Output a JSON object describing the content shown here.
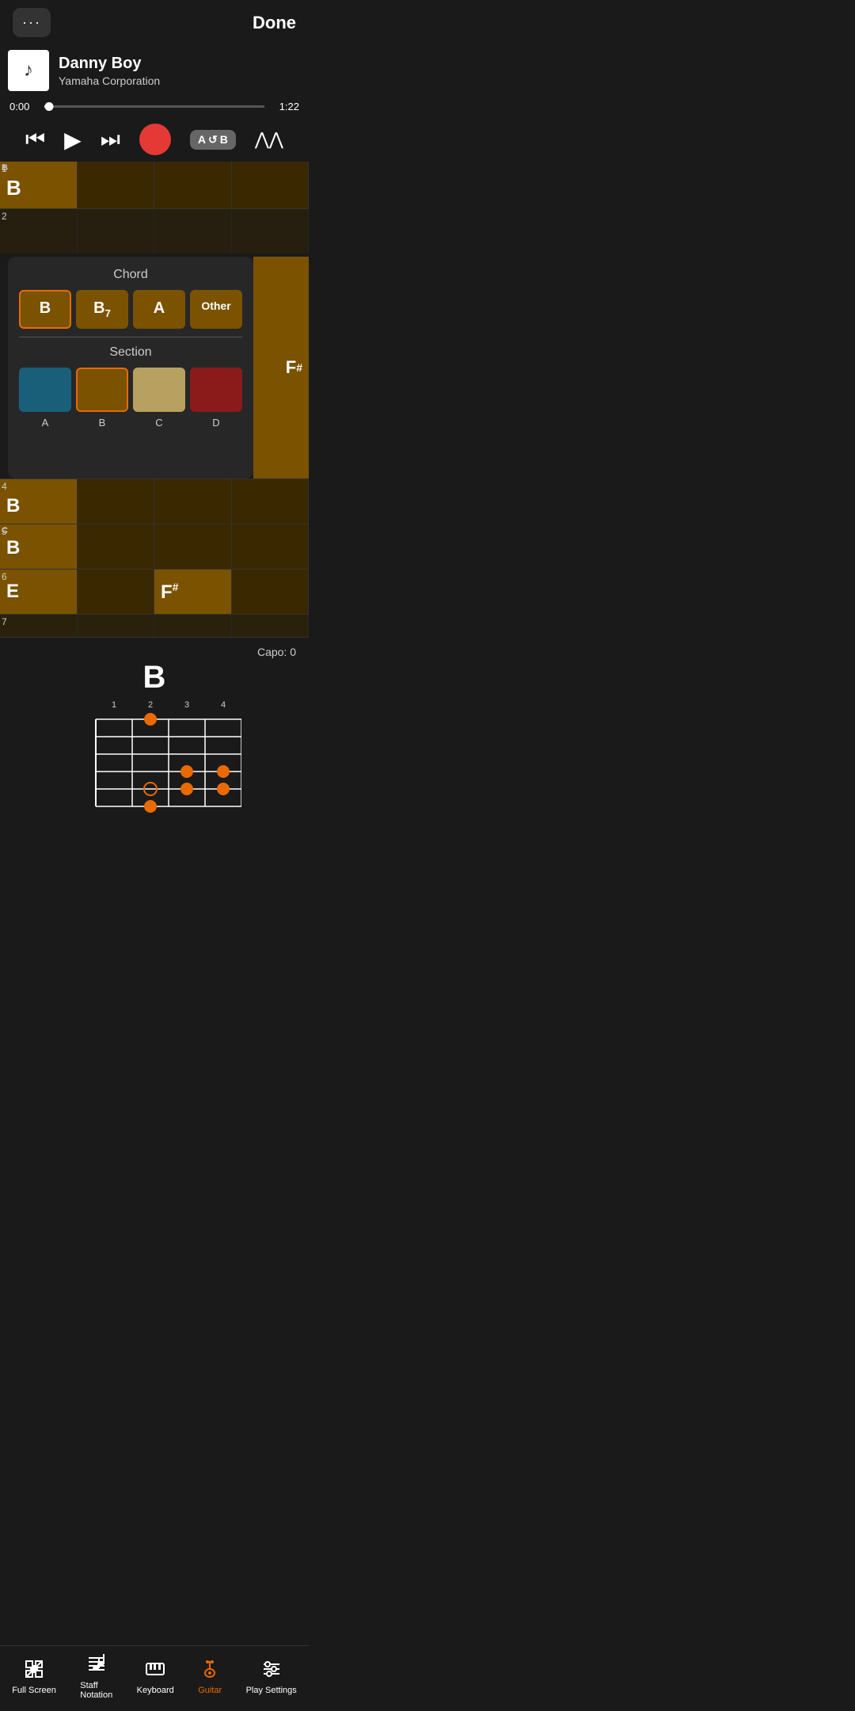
{
  "header": {
    "dots_label": "···",
    "done_label": "Done"
  },
  "song": {
    "title": "Danny Boy",
    "artist": "Yamaha Corporation",
    "time_current": "0:00",
    "time_total": "1:22",
    "progress_pct": 2
  },
  "controls": {
    "rewind": "⏮",
    "play": "▶",
    "fast_forward": "⏭",
    "ab_label": "A↺B"
  },
  "popup": {
    "chord_title": "Chord",
    "chord_options": [
      "B",
      "B₇",
      "A",
      "Other"
    ],
    "section_title": "Section",
    "section_options": [
      "A",
      "B",
      "C",
      "D"
    ],
    "section_colors": [
      "#1a5f7a",
      "#7a5200",
      "#b8a060",
      "#8b1a1a"
    ],
    "selected_chord": 0,
    "selected_section": 1
  },
  "measures": {
    "rows": [
      {
        "num": "1",
        "cells": [
          {
            "label": "B",
            "note": "B"
          },
          {
            "label": "",
            "note": ""
          },
          {
            "label": "",
            "note": ""
          },
          {
            "label": "",
            "note": ""
          }
        ]
      },
      {
        "num": "2",
        "cells": [
          {
            "label": "",
            "note": ""
          },
          {
            "label": "",
            "note": ""
          },
          {
            "label": "",
            "note": ""
          },
          {
            "label": "",
            "note": ""
          }
        ]
      },
      {
        "num": "3",
        "cells": [
          {
            "label": "",
            "note": ""
          },
          {
            "label": "",
            "note": ""
          },
          {
            "label": "F#",
            "note": "F#"
          },
          {
            "label": "",
            "note": ""
          }
        ]
      },
      {
        "num": "4",
        "cells": [
          {
            "label": "B",
            "note": "B"
          },
          {
            "label": "",
            "note": ""
          },
          {
            "label": "",
            "note": ""
          },
          {
            "label": "",
            "note": ""
          }
        ]
      },
      {
        "num": "5",
        "cells": [
          {
            "label": "B",
            "note": "B",
            "note_label": "C"
          },
          {
            "label": "",
            "note": ""
          },
          {
            "label": "",
            "note": ""
          },
          {
            "label": "",
            "note": ""
          }
        ]
      },
      {
        "num": "6",
        "cells": [
          {
            "label": "E",
            "note": "E"
          },
          {
            "label": "",
            "note": ""
          },
          {
            "label": "F#",
            "note": "F#"
          },
          {
            "label": "",
            "note": ""
          }
        ]
      },
      {
        "num": "7",
        "cells": [
          {
            "label": "",
            "note": ""
          },
          {
            "label": "",
            "note": ""
          },
          {
            "label": "",
            "note": ""
          },
          {
            "label": "",
            "note": ""
          }
        ]
      }
    ]
  },
  "chord_diagram": {
    "chord_name": "B",
    "capo": "Capo: 0",
    "fret_numbers": [
      "1",
      "2",
      "3",
      "4"
    ],
    "dots": [
      {
        "string": 3,
        "fret": 1
      },
      {
        "string": 5,
        "fret": 3
      },
      {
        "string": 5,
        "fret": 3
      },
      {
        "string": 6,
        "fret": 3
      },
      {
        "string": 5,
        "fret": 4
      },
      {
        "string": 6,
        "fret": 2
      },
      {
        "string": 1,
        "fret": 3
      }
    ]
  },
  "bottom_nav": {
    "items": [
      {
        "label": "Full Screen",
        "icon": "fullscreen"
      },
      {
        "label": "Staff Notation",
        "icon": "staff"
      },
      {
        "label": "Keyboard",
        "icon": "keyboard"
      },
      {
        "label": "Guitar",
        "icon": "guitar"
      },
      {
        "label": "Play Settings",
        "icon": "settings"
      }
    ],
    "active": 3
  }
}
